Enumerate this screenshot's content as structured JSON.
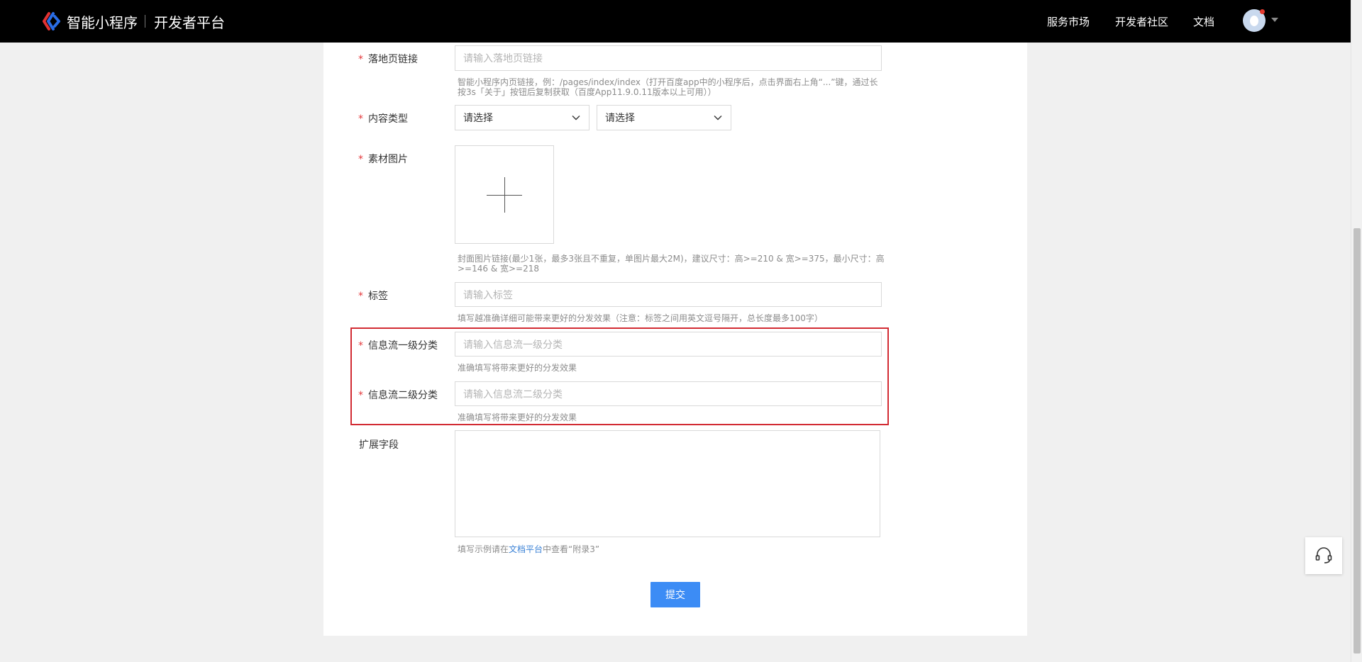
{
  "header": {
    "brand": "智能小程序",
    "platform": "开发者平台",
    "nav": [
      "服务市场",
      "开发者社区",
      "文档"
    ]
  },
  "form": {
    "landing_page": {
      "label": "落地页链接",
      "placeholder": "请输入落地页链接",
      "hint_line1": "智能小程序内页链接，例：/pages/index/index（打开百度app中的小程序后，点击界面右上角“...”键，通过长",
      "hint_line2": "按3s「关于」按钮后复制获取（百度App11.9.0.11版本以上可用））"
    },
    "content_type": {
      "label": "内容类型",
      "select1": "请选择",
      "select2": "请选择"
    },
    "material_image": {
      "label": "素材图片",
      "hint_line1": "封面图片链接(最少1张，最多3张且不重复，单图片最大2M)，建议尺寸：高>=210 & 宽>=375，最小尺寸：高",
      "hint_line2": ">=146 & 宽>=218"
    },
    "tags": {
      "label": "标签",
      "placeholder": "请输入标签",
      "hint": "填写越准确详细可能带来更好的分发效果（注意：标签之间用英文逗号隔开，总长度最多100字）"
    },
    "feed_level1": {
      "label": "信息流一级分类",
      "placeholder": "请输入信息流一级分类",
      "hint": "准确填写将带来更好的分发效果"
    },
    "feed_level2": {
      "label": "信息流二级分类",
      "placeholder": "请输入信息流二级分类",
      "hint": "准确填写将带来更好的分发效果"
    },
    "extension": {
      "label": "扩展字段",
      "hint_prefix": "填写示例请在",
      "hint_link": "文档平台",
      "hint_suffix": "中查看“附录3”"
    },
    "required_mark": "*",
    "submit_label": "提交"
  }
}
